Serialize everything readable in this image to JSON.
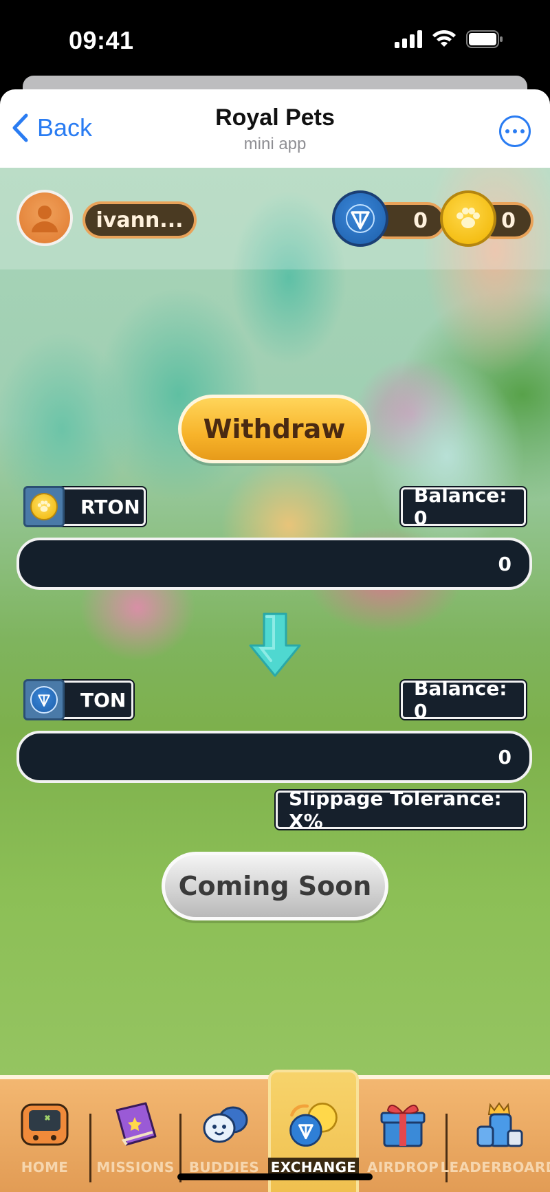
{
  "status_bar": {
    "time": "09:41"
  },
  "header": {
    "back_label": "Back",
    "title": "Royal Pets",
    "subtitle": "mini app"
  },
  "profile": {
    "username": "ivann..."
  },
  "currencies": [
    {
      "name": "ton-coin",
      "value": "0"
    },
    {
      "name": "paw-coin",
      "value": "0"
    }
  ],
  "exchange": {
    "withdraw_label": "Withdraw",
    "from": {
      "token": "RTON",
      "balance": "Balance: 0",
      "amount": "0"
    },
    "to": {
      "token": "TON",
      "balance": "Balance: 0",
      "amount": "0"
    },
    "slippage_label": "Slippage Tolerance: X%",
    "submit_label": "Coming Soon"
  },
  "tabs": [
    {
      "label": "HOME",
      "icon": "console-icon"
    },
    {
      "label": "MISSIONS",
      "icon": "book-icon"
    },
    {
      "label": "BUDDIES",
      "icon": "chat-buddies-icon"
    },
    {
      "label": "EXCHANGE",
      "icon": "exchange-coins-icon",
      "active": true
    },
    {
      "label": "AIRDROP",
      "icon": "gift-icon"
    },
    {
      "label": "LEADERBOARD",
      "icon": "trophy-icon"
    }
  ],
  "colors": {
    "accent_blue": "#2A7CF2",
    "gold": "#F7B32A",
    "panel_dark": "#141F2B",
    "tab_orange": "#E29C55"
  }
}
